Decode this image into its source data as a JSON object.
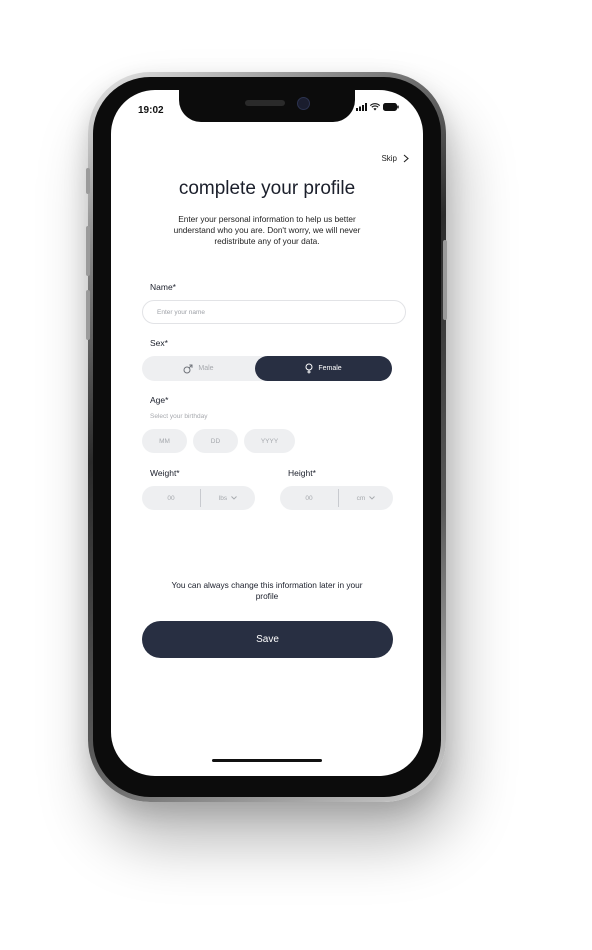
{
  "status_bar": {
    "time": "19:02"
  },
  "header": {
    "skip_label": "Skip",
    "title": "complete your profile",
    "subtitle": "Enter your personal information to help us better understand who you are. Don't worry, we will never redistribute any of your data."
  },
  "form": {
    "name": {
      "label": "Name*",
      "placeholder": "Enter your name"
    },
    "sex": {
      "label": "Sex*",
      "options": [
        "Male",
        "Female"
      ],
      "selected": "Female"
    },
    "age": {
      "label": "Age*",
      "hint": "Select your birthday",
      "mm": "MM",
      "dd": "DD",
      "yyyy": "YYYY"
    },
    "weight": {
      "label": "Weight*",
      "value": "00",
      "unit": "lbs"
    },
    "height": {
      "label": "Height*",
      "value": "00",
      "unit": "cm"
    }
  },
  "footer": {
    "note": "You can always change this information later in your profile",
    "save_label": "Save"
  },
  "colors": {
    "primary": "#282f42",
    "input_bg": "#eeeff1",
    "placeholder": "#a5a8ad"
  },
  "icons": [
    "signal-icon",
    "wifi-icon",
    "battery-icon",
    "chevron-right-icon",
    "male-icon",
    "female-icon",
    "chevron-down-icon"
  ]
}
